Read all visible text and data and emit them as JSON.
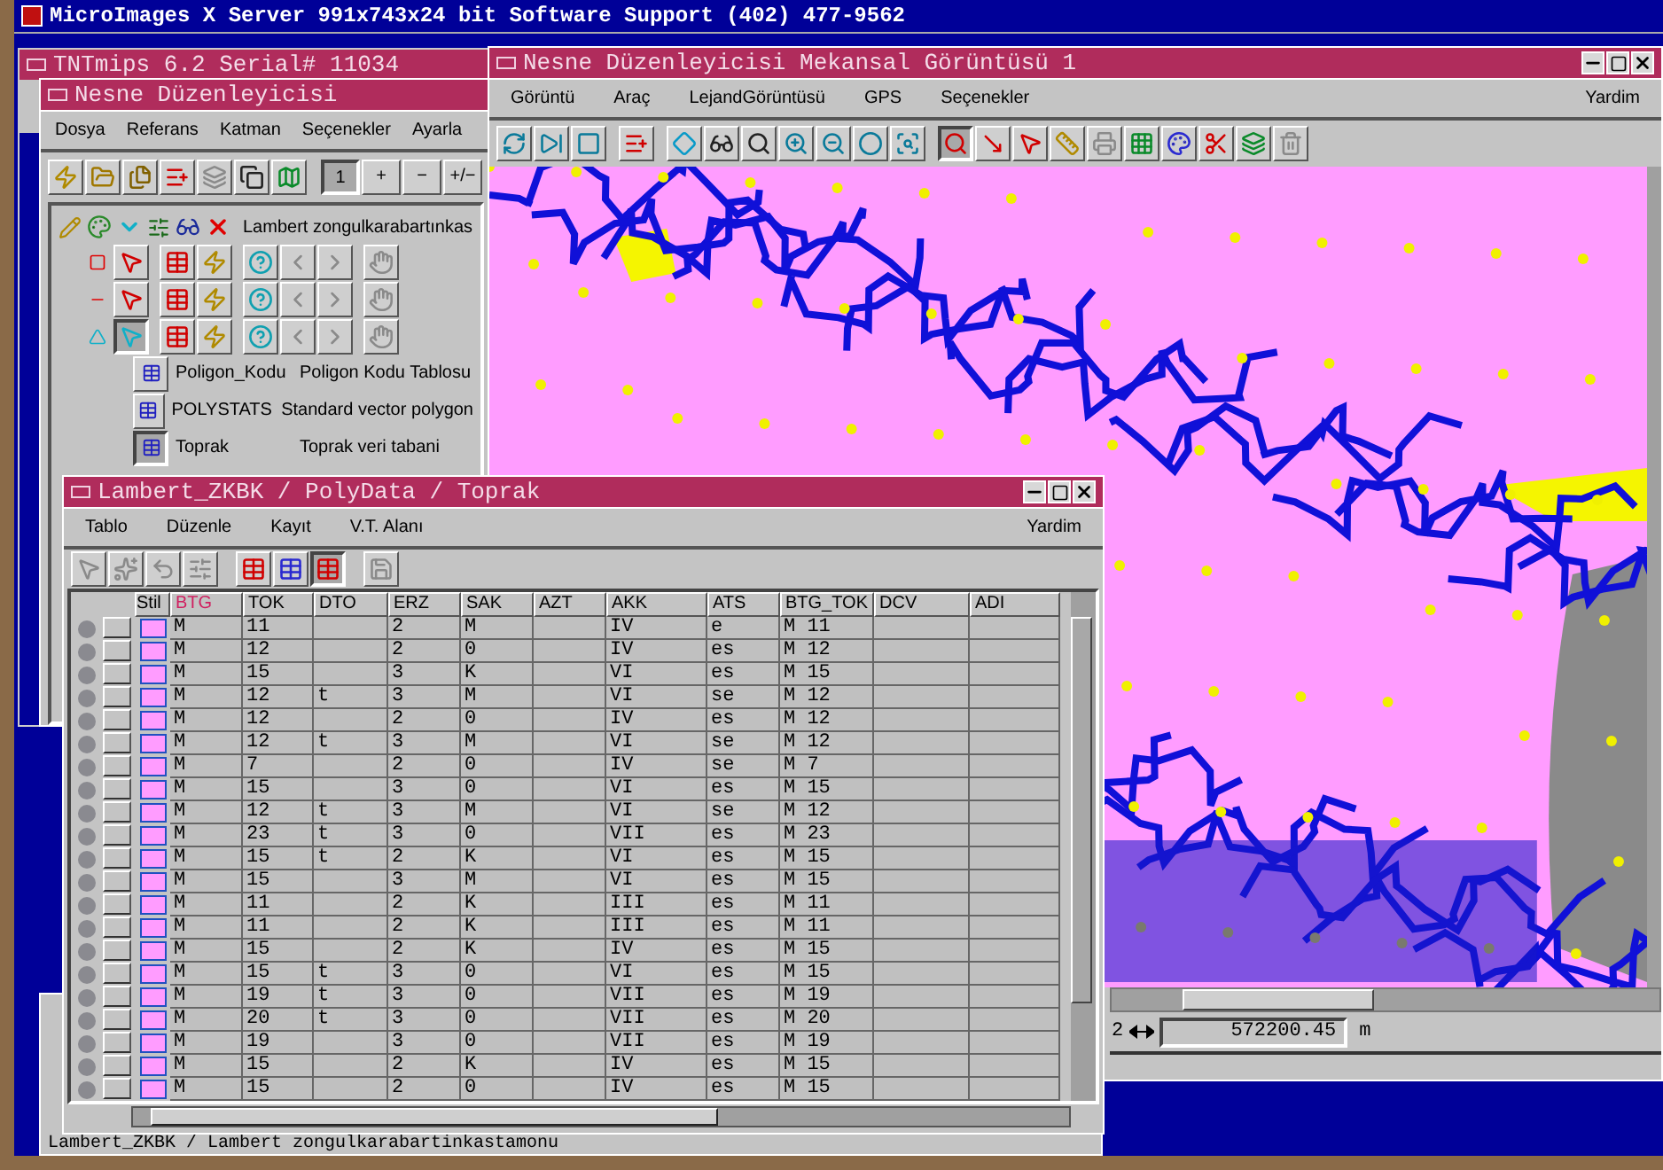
{
  "desktop": {
    "title": "MicroImages X Server  991x743x24 bit  Software Support (402) 477-9562"
  },
  "tntmips_window": {
    "title": "TNTmips 6.2  Serial# 11034"
  },
  "object_editor": {
    "title": "Nesne Düzenleyicisi",
    "menu": [
      "Dosya",
      "Referans",
      "Katman",
      "Seçenekler",
      "Ayarla"
    ],
    "select_modes": [
      {
        "label": "1",
        "selected": true
      },
      {
        "label": "+",
        "selected": false
      },
      {
        "label": "−",
        "selected": false
      },
      {
        "label": "+/−",
        "selected": false
      }
    ],
    "layer": {
      "name": "Lambert zongulkarabartınkas"
    },
    "tables": [
      {
        "name": "Poligon_Kodu",
        "description": "Poligon Kodu Tablosu",
        "selected": false
      },
      {
        "name": "POLYSTATS",
        "description": "Standard vector polygon",
        "selected": false
      },
      {
        "name": "Toprak",
        "description": "Toprak veri tabani",
        "selected": true
      }
    ]
  },
  "map_window": {
    "title": "Nesne Düzenleyicisi Mekansal Görüntüsü 1",
    "menu": [
      "Görüntü",
      "Araç",
      "LejandGörüntüsü",
      "GPS",
      "Seçenekler"
    ],
    "help_menu": "Yardim",
    "scale_prefix": "2",
    "distance": "572200.45",
    "unit": "m"
  },
  "table_window": {
    "title": "Lambert_ZKBK / PolyData / Toprak",
    "menu": [
      "Tablo",
      "Düzenle",
      "Kayıt",
      "V.T. Alanı"
    ],
    "help_menu": "Yardim",
    "style_header": "Stil",
    "columns": [
      {
        "label": "BTG",
        "selected": true
      },
      {
        "label": "TOK",
        "selected": false
      },
      {
        "label": "DTO",
        "selected": false
      },
      {
        "label": "ERZ",
        "selected": false
      },
      {
        "label": "SAK",
        "selected": false
      },
      {
        "label": "AZT",
        "selected": false
      },
      {
        "label": "AKK",
        "selected": false
      },
      {
        "label": "ATS",
        "selected": false
      },
      {
        "label": "BTG_TOK",
        "selected": false
      },
      {
        "label": "DCV",
        "selected": false
      },
      {
        "label": "ADI",
        "selected": false
      }
    ],
    "rows": [
      [
        "M",
        "11",
        null,
        "2",
        "M",
        null,
        "IV",
        "e",
        "M 11",
        null,
        null
      ],
      [
        "M",
        "12",
        null,
        "2",
        "0",
        null,
        "IV",
        "es",
        "M 12",
        null,
        null
      ],
      [
        "M",
        "15",
        null,
        "3",
        "K",
        null,
        "VI",
        "es",
        "M 15",
        null,
        null
      ],
      [
        "M",
        "12",
        "t",
        "3",
        "M",
        null,
        "VI",
        "se",
        "M 12",
        null,
        null
      ],
      [
        "M",
        "12",
        null,
        "2",
        "0",
        null,
        "IV",
        "es",
        "M 12",
        null,
        null
      ],
      [
        "M",
        "12",
        "t",
        "3",
        "M",
        null,
        "VI",
        "se",
        "M 12",
        null,
        null
      ],
      [
        "M",
        "7",
        null,
        "2",
        "0",
        null,
        "IV",
        "se",
        "M 7",
        null,
        null
      ],
      [
        "M",
        "15",
        null,
        "3",
        "0",
        null,
        "VI",
        "es",
        "M 15",
        null,
        null
      ],
      [
        "M",
        "12",
        "t",
        "3",
        "M",
        null,
        "VI",
        "se",
        "M 12",
        null,
        null
      ],
      [
        "M",
        "23",
        "t",
        "3",
        "0",
        null,
        "VII",
        "es",
        "M 23",
        null,
        null
      ],
      [
        "M",
        "15",
        "t",
        "2",
        "K",
        null,
        "VI",
        "es",
        "M 15",
        null,
        null
      ],
      [
        "M",
        "15",
        null,
        "3",
        "M",
        null,
        "VI",
        "es",
        "M 15",
        null,
        null
      ],
      [
        "M",
        "11",
        null,
        "2",
        "K",
        null,
        "III",
        "es",
        "M 11",
        null,
        null
      ],
      [
        "M",
        "11",
        null,
        "2",
        "K",
        null,
        "III",
        "es",
        "M 11",
        null,
        null
      ],
      [
        "M",
        "15",
        null,
        "2",
        "K",
        null,
        "IV",
        "es",
        "M 15",
        null,
        null
      ],
      [
        "M",
        "15",
        "t",
        "3",
        "0",
        null,
        "VI",
        "es",
        "M 15",
        null,
        null
      ],
      [
        "M",
        "19",
        "t",
        "3",
        "0",
        null,
        "VII",
        "es",
        "M 19",
        null,
        null
      ],
      [
        "M",
        "20",
        "t",
        "3",
        "0",
        null,
        "VII",
        "es",
        "M 20",
        null,
        null
      ],
      [
        "M",
        "19",
        null,
        "3",
        "0",
        null,
        "VII",
        "es",
        "M 19",
        null,
        null
      ],
      [
        "M",
        "15",
        null,
        "2",
        "K",
        null,
        "IV",
        "es",
        "M 15",
        null,
        null
      ],
      [
        "M",
        "15",
        null,
        "2",
        "0",
        null,
        "IV",
        "es",
        "M 15",
        null,
        null
      ]
    ]
  },
  "status_bar": "Lambert_ZKBK / Lambert zongulkarabartinkastamonu"
}
